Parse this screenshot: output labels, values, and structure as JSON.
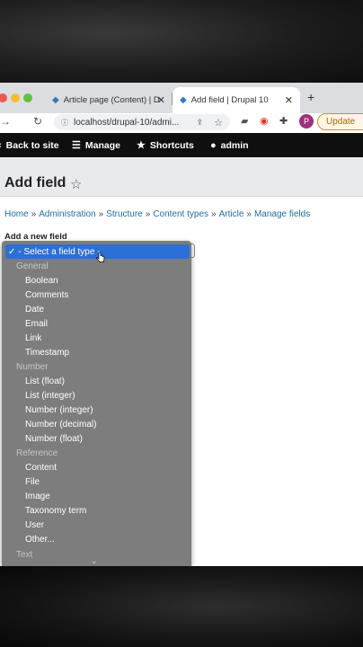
{
  "browser": {
    "tabs": [
      {
        "title": "Article page (Content) | D"
      },
      {
        "title": "Add field | Drupal 10"
      }
    ],
    "new_tab": "+",
    "close": "✕",
    "url": "localhost/drupal-10/admi...",
    "profile_initial": "P",
    "update_label": "Update"
  },
  "toolbar": {
    "back": "Back to site",
    "manage": "Manage",
    "shortcuts": "Shortcuts",
    "user": "admin"
  },
  "page": {
    "title": "Add field",
    "breadcrumb": [
      "Home",
      "Administration",
      "Structure",
      "Content types",
      "Article",
      "Manage fields"
    ],
    "add_new_label": "Add a new field"
  },
  "dropdown": {
    "selected": "- Select a field type -",
    "options": [
      {
        "type": "group",
        "label": "General"
      },
      {
        "type": "item",
        "label": "Boolean"
      },
      {
        "type": "item",
        "label": "Comments"
      },
      {
        "type": "item",
        "label": "Date"
      },
      {
        "type": "item",
        "label": "Email"
      },
      {
        "type": "item",
        "label": "Link"
      },
      {
        "type": "item",
        "label": "Timestamp"
      },
      {
        "type": "group",
        "label": "Number"
      },
      {
        "type": "item",
        "label": "List (float)"
      },
      {
        "type": "item",
        "label": "List (integer)"
      },
      {
        "type": "item",
        "label": "Number (integer)"
      },
      {
        "type": "item",
        "label": "Number (decimal)"
      },
      {
        "type": "item",
        "label": "Number (float)"
      },
      {
        "type": "group",
        "label": "Reference"
      },
      {
        "type": "item",
        "label": "Content"
      },
      {
        "type": "item",
        "label": "File"
      },
      {
        "type": "item",
        "label": "Image"
      },
      {
        "type": "item",
        "label": "Taxonomy term"
      },
      {
        "type": "item",
        "label": "User"
      },
      {
        "type": "item",
        "label": "Other..."
      },
      {
        "type": "group",
        "label": "Text"
      }
    ]
  }
}
